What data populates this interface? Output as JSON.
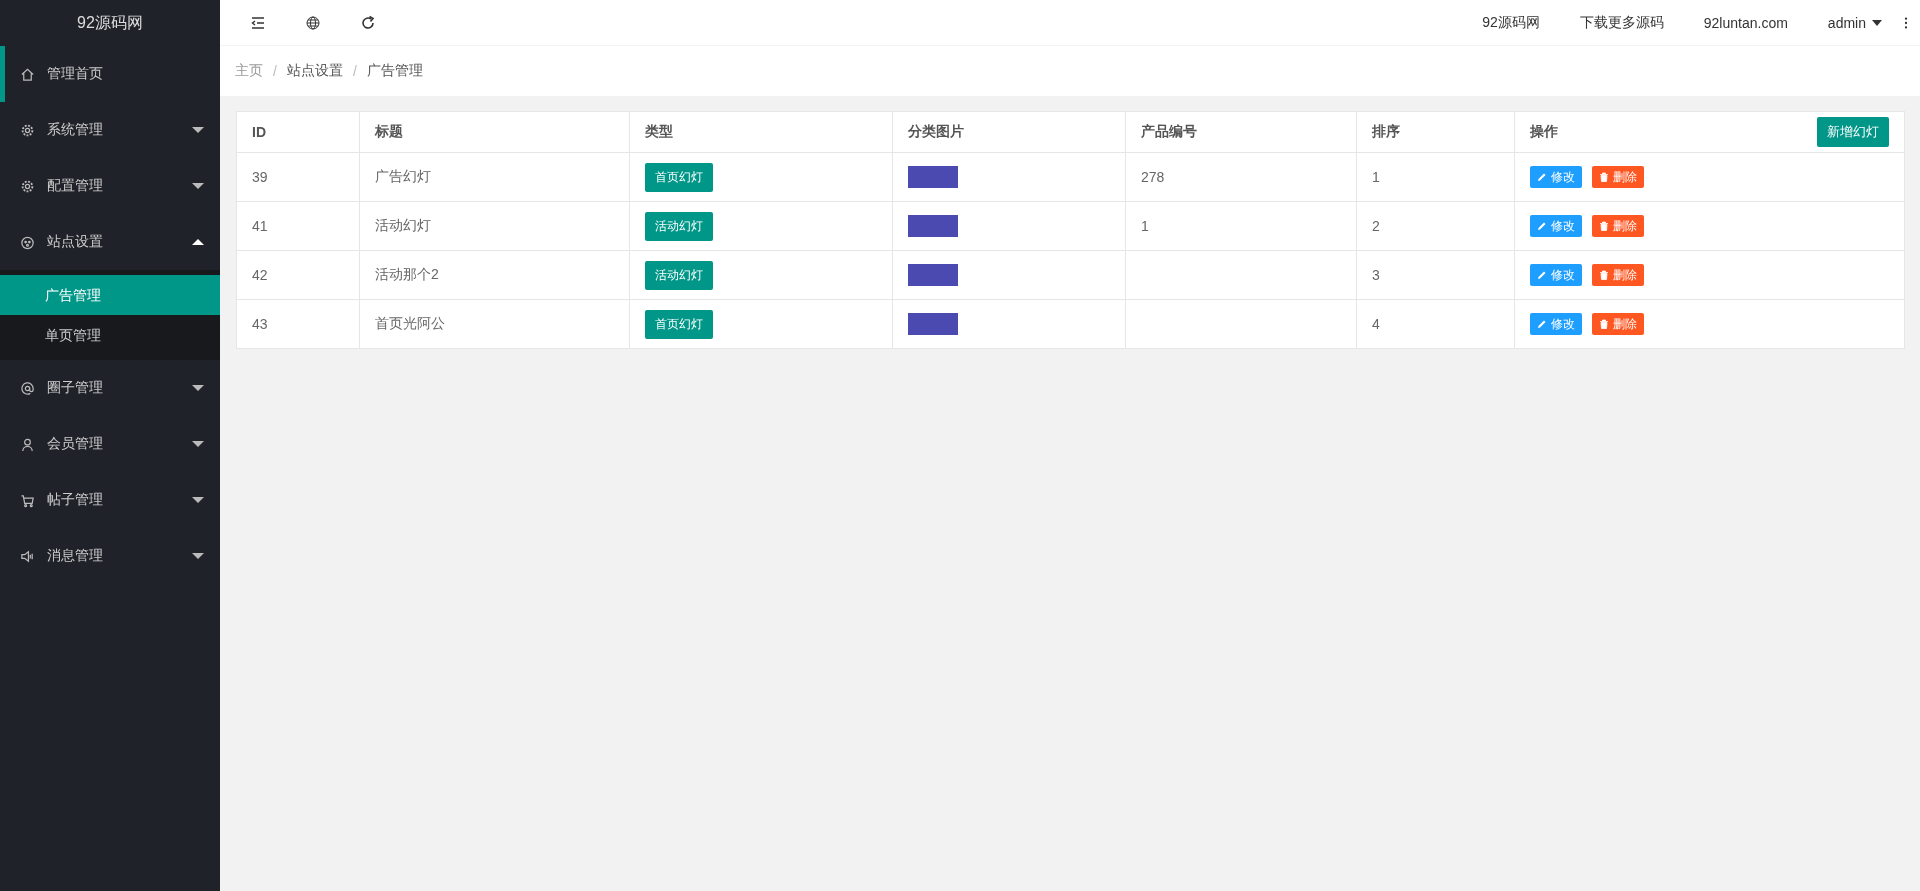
{
  "sidebar": {
    "logo": "92源码网",
    "items": [
      {
        "label": "管理首页",
        "kind": "home",
        "selected": true
      },
      {
        "label": "系统管理",
        "kind": "gear",
        "expanded": false,
        "selected": false
      },
      {
        "label": "配置管理",
        "kind": "gear",
        "expanded": false,
        "selected": false
      },
      {
        "label": "站点设置",
        "kind": "face",
        "expanded": true,
        "selected": false,
        "children": [
          {
            "label": "广告管理",
            "selected": true
          },
          {
            "label": "单页管理",
            "selected": false
          }
        ]
      },
      {
        "label": "圈子管理",
        "kind": "at",
        "expanded": false,
        "selected": false
      },
      {
        "label": "会员管理",
        "kind": "user",
        "expanded": false,
        "selected": false
      },
      {
        "label": "帖子管理",
        "kind": "cart",
        "expanded": false,
        "selected": false
      },
      {
        "label": "消息管理",
        "kind": "speaker",
        "expanded": false,
        "selected": false
      }
    ]
  },
  "topbar": {
    "links": [
      "92源码网",
      "下载更多源码",
      "92luntan.com"
    ],
    "user": "admin"
  },
  "breadcrumb": [
    {
      "label": "主页"
    },
    {
      "separator": "/",
      "label": "站点设置"
    },
    {
      "separator": "/",
      "label": "广告管理"
    }
  ],
  "table": {
    "columns": [
      "ID",
      "标题",
      "类型",
      "分类图片",
      "产品编号",
      "排序",
      "操作"
    ],
    "add_button": "新增幻灯",
    "rows": [
      {
        "id": "39",
        "title": "广告幻灯",
        "type": "首页幻灯",
        "product": "278",
        "order": "1",
        "edit": "修改",
        "delete": "删除"
      },
      {
        "id": "41",
        "title": "活动幻灯",
        "type": "活动幻灯",
        "product": "1",
        "order": "2",
        "edit": "修改",
        "delete": "删除"
      },
      {
        "id": "42",
        "title": "活动那个2",
        "type": "活动幻灯",
        "product": "",
        "order": "3",
        "edit": "修改",
        "delete": "删除"
      },
      {
        "id": "43",
        "title": "首页光阿公",
        "type": "首页幻灯",
        "product": "",
        "order": "4",
        "edit": "修改",
        "delete": "删除"
      }
    ]
  }
}
